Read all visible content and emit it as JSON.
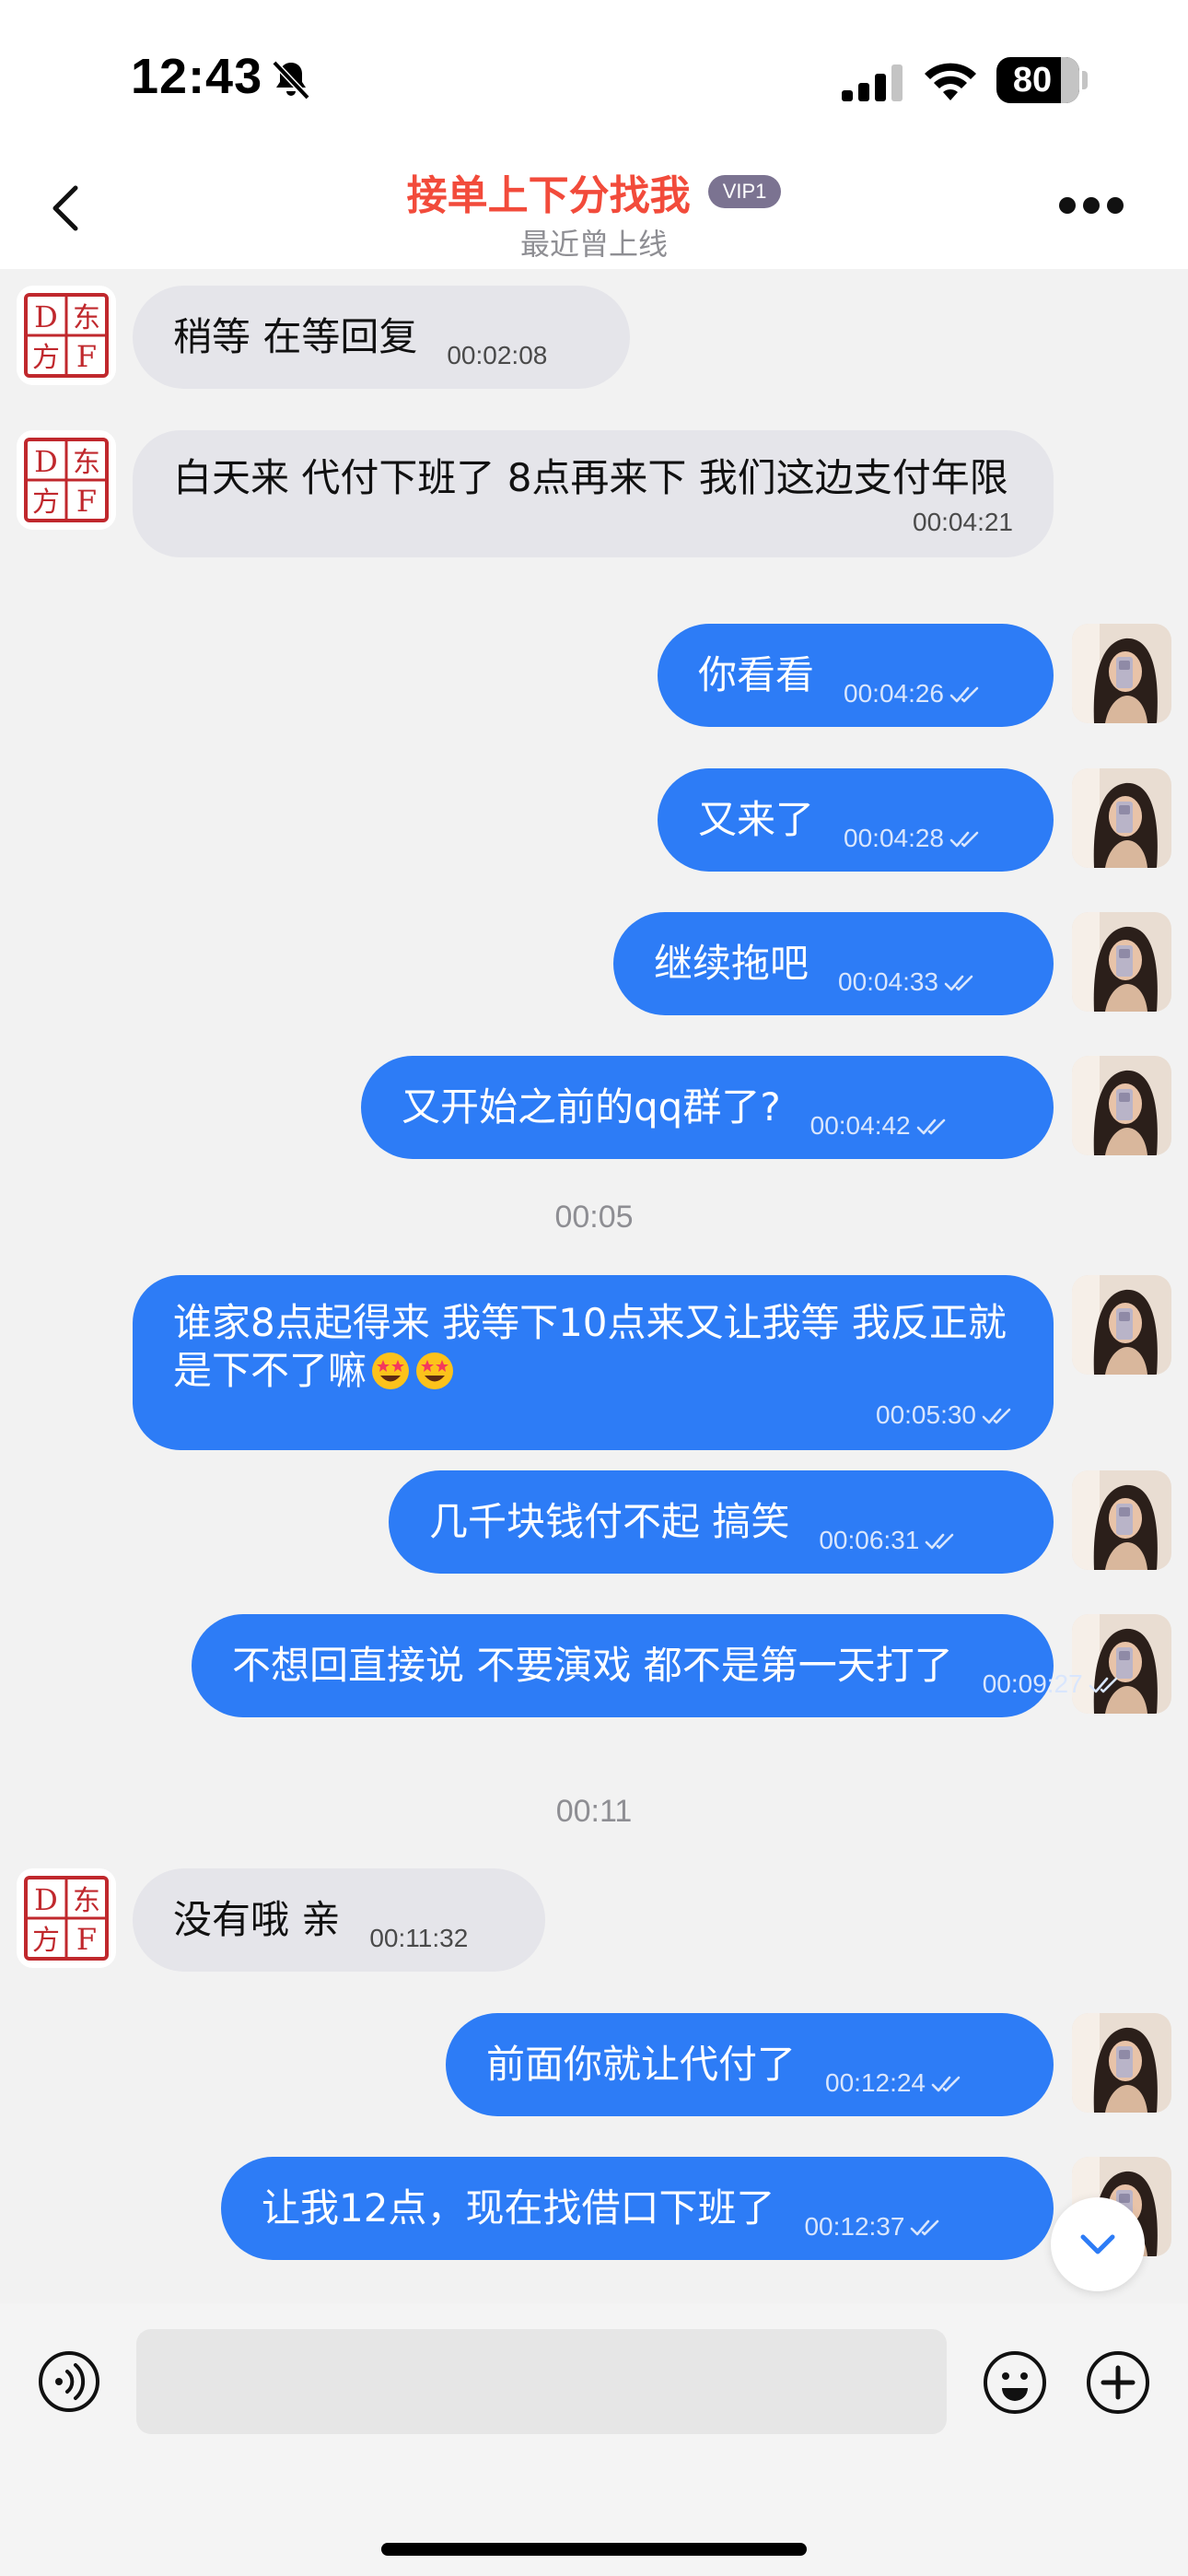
{
  "status_bar": {
    "time": "12:43",
    "battery": "80",
    "battery_level": 0.8,
    "icons": [
      "mute-bell-icon",
      "cellular-signal-icon",
      "wifi-icon",
      "battery-icon"
    ]
  },
  "header": {
    "title": "接单上下分找我",
    "badge": "VIP1",
    "subtitle": "最近曾上线",
    "icons": [
      "back-chevron-icon",
      "more-dots-icon"
    ]
  },
  "contact_avatar": {
    "chars": [
      "D",
      "东",
      "方",
      "F"
    ]
  },
  "colors": {
    "title": "#f24b3b",
    "outgoing_bubble": "#2d7cf6",
    "incoming_bubble": "#e5e5ea",
    "background": "#f2f2f2"
  },
  "messages": [
    {
      "dir": "in",
      "text": "稍等 在等回复",
      "time": "00:02:08"
    },
    {
      "dir": "in",
      "text": "白天来 代付下班了 8点再来下 我们这边支付年限",
      "time": "00:04:21"
    },
    {
      "dir": "out",
      "text": "你看看",
      "time": "00:04:26"
    },
    {
      "dir": "out",
      "text": "又来了",
      "time": "00:04:28"
    },
    {
      "dir": "out",
      "text": "继续拖吧",
      "time": "00:04:33"
    },
    {
      "dir": "out",
      "text": "又开始之前的qq群了?",
      "time": "00:04:42"
    },
    {
      "divider": "00:05"
    },
    {
      "dir": "out",
      "text": "谁家8点起得来 我等下10点来又让我等 我反正就是下不了嘛",
      "emoji": [
        "star-struck-emoji",
        "star-struck-emoji"
      ],
      "time": "00:05:30"
    },
    {
      "dir": "out",
      "text": "几千块钱付不起 搞笑",
      "time": "00:06:31"
    },
    {
      "dir": "out",
      "text": "不想回直接说 不要演戏 都不是第一天打了",
      "time": "00:09:27"
    },
    {
      "divider": "00:11"
    },
    {
      "dir": "in",
      "text": "没有哦 亲",
      "time": "00:11:32"
    },
    {
      "dir": "out",
      "text": "前面你就让代付了",
      "time": "00:12:24"
    },
    {
      "dir": "out",
      "text": "让我12点，现在找借口下班了",
      "time": "00:12:37"
    }
  ],
  "input_bar": {
    "value": "",
    "icons": [
      "voice-icon",
      "emoji-icon",
      "plus-icon",
      "scroll-down-chevron-icon"
    ]
  }
}
